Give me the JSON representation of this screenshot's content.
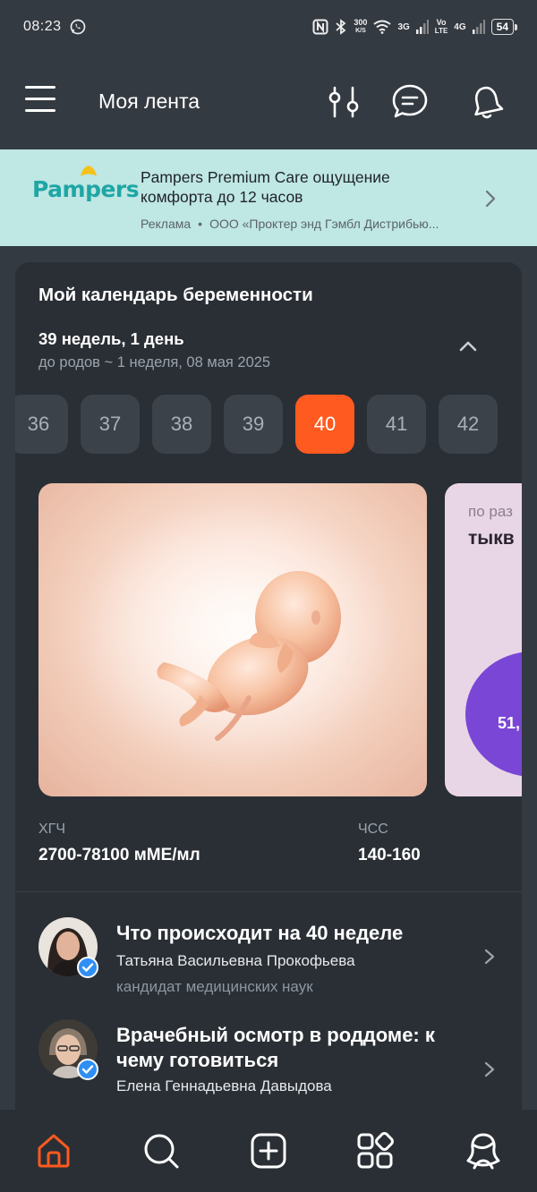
{
  "status_bar": {
    "time": "08:23",
    "net_speed_value": "300",
    "net_speed_unit": "K/S",
    "sim1": "3G",
    "volte_top": "Vo",
    "volte_bottom": "LTE",
    "sim2": "4G",
    "battery": "54"
  },
  "app_bar": {
    "title": "Моя лента"
  },
  "ad": {
    "brand": "Pampers",
    "headline": "Pampers Premium Care ощущение комфорта до 12 часов",
    "label": "Реклама",
    "separator": "•",
    "advertiser": "ООО «Проктер энд Гэмбл Дистрибью..."
  },
  "calendar": {
    "title": "Мой календарь беременности",
    "weeks_days": "39 недель, 1 день",
    "due_info": "до родов ~ 1 неделя, 08 мая 2025",
    "weeks": [
      "36",
      "37",
      "38",
      "39",
      "40",
      "41",
      "42"
    ],
    "selected_week": "40",
    "size_card": {
      "caption": "по раз",
      "fruit": "тыкв",
      "measure": "51,"
    },
    "stats": [
      {
        "label": "ХГЧ",
        "value": "2700-78100 мМЕ/мл"
      },
      {
        "label": "ЧСС",
        "value": "140-160"
      }
    ]
  },
  "articles": [
    {
      "title": "Что происходит на 40 неделе",
      "author": "Татьяна Васильевна Прокофьева",
      "degree": "кандидат медицинских наук"
    },
    {
      "title": "Врачебный осмотр в роддоме: к чему готовиться",
      "author": "Елена Геннадьевна Давыдова"
    }
  ],
  "colors": {
    "background": "#343a42",
    "card": "#2a2f35",
    "accent": "#ff5a1f",
    "ad_background": "#bfe7e4",
    "verified": "#2f8ff5"
  },
  "icons": {
    "app_bar": [
      "menu-icon",
      "filter-icon",
      "chat-icon",
      "bell-icon"
    ],
    "bottom_nav": [
      "home-icon",
      "search-icon",
      "add-icon",
      "services-icon",
      "profile-icon"
    ]
  }
}
